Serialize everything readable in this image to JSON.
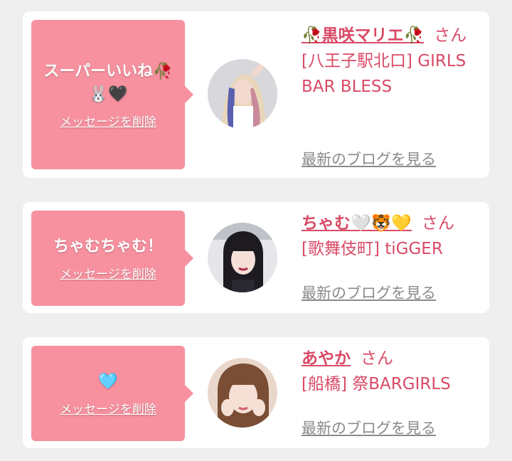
{
  "colors": {
    "bubble": "#f7919f",
    "accent": "#d94a66",
    "link_gray": "#8a8a8a",
    "background": "#efefef"
  },
  "cards": [
    {
      "message_line1": "スーパーいいね🥀",
      "message_line2": "🐰🖤",
      "delete_label": "メッセージを削除",
      "name": "🥀黒咲マリエ🥀",
      "san": "さん",
      "shop": "[八王子駅北口] GIRLS BAR BLESS",
      "blog_label": "最新のブログを見る"
    },
    {
      "message_line1": "ちゃむちゃむ！",
      "message_line2": "",
      "delete_label": "メッセージを削除",
      "name": "ちゃむ🤍🐯💛",
      "san": "さん",
      "shop": "[歌舞伎町] tiGGER",
      "blog_label": "最新のブログを見る"
    },
    {
      "message_line1": "🩵",
      "message_line2": "",
      "delete_label": "メッセージを削除",
      "name": "あやか",
      "san": "さん",
      "shop": "[船橋] 祭BARGIRLS",
      "blog_label": "最新のブログを見る"
    }
  ]
}
